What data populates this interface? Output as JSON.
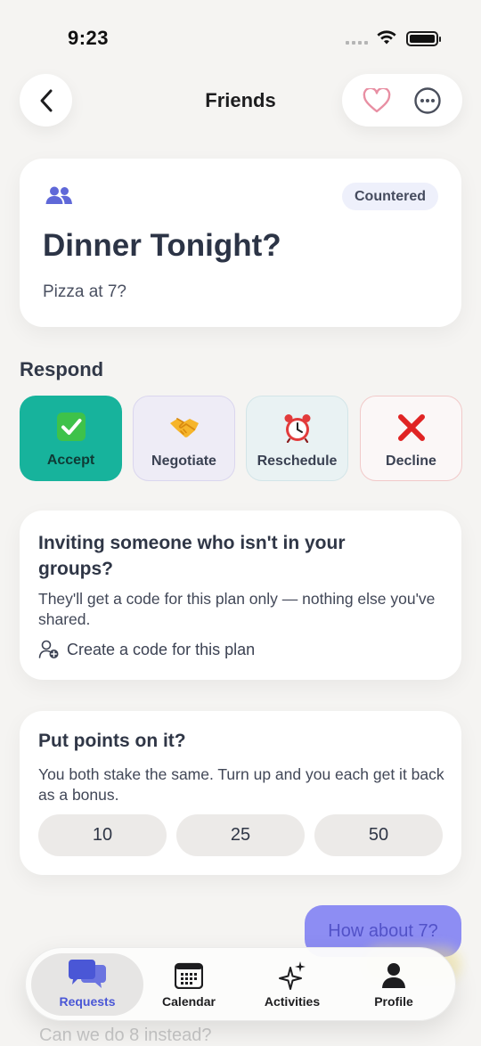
{
  "status_bar": {
    "time": "9:23"
  },
  "header": {
    "title": "Friends"
  },
  "plan": {
    "status_badge": "Countered",
    "title": "Dinner Tonight?",
    "subtitle": "Pizza at 7?"
  },
  "respond": {
    "label": "Respond",
    "options": [
      {
        "label": "Accept",
        "icon": "check-emoji",
        "color": "#17b39c"
      },
      {
        "label": "Negotiate",
        "icon": "handshake-emoji"
      },
      {
        "label": "Reschedule",
        "icon": "alarm-clock-emoji"
      },
      {
        "label": "Decline",
        "icon": "cross-emoji"
      }
    ]
  },
  "invite": {
    "title": "Inviting someone who isn't in your groups?",
    "body": "They'll get a code for this plan only — nothing else you've shared.",
    "link": "Create a code for this plan"
  },
  "points": {
    "title": "Put points on it?",
    "body": "You both stake the same. Turn up and you each get it back as a bonus.",
    "options": [
      "10",
      "25",
      "50"
    ]
  },
  "chat": {
    "bubble": "How about 7?",
    "message": "Can we do 8 instead?"
  },
  "tabs": [
    {
      "label": "Requests",
      "icon": "chat-bubbles-icon",
      "active": true
    },
    {
      "label": "Calendar",
      "icon": "calendar-icon"
    },
    {
      "label": "Activities",
      "icon": "sparkles-icon"
    },
    {
      "label": "Profile",
      "icon": "person-icon"
    }
  ],
  "colors": {
    "background": "#f5f4f2",
    "accent": "#4a57d6",
    "accept": "#17b39c",
    "decline_red": "#e02424",
    "heart_pink": "#e88fa3"
  }
}
